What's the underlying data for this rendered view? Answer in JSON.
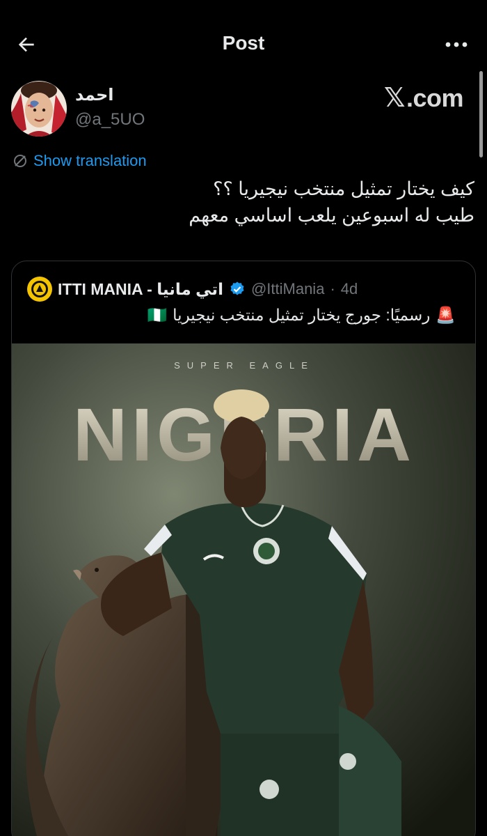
{
  "header": {
    "title": "Post",
    "back_icon": "arrow-left-icon",
    "more_icon": "more-horizontal-icon"
  },
  "author": {
    "name": "احمد",
    "handle": "@a_5UO"
  },
  "watermark": {
    "x": "𝕏",
    "text": ".com"
  },
  "translation": {
    "label": "Show translation"
  },
  "tweet": {
    "lines": [
      "كيف يختار تمثيل منتخب نيجيريا ؟؟",
      "طيب له اسبوعين يلعب اساسي معهم"
    ]
  },
  "quote": {
    "name": "ITTI MANIA - اتي مانيا",
    "handle": "@IttiMania",
    "separator": "·",
    "time": "4d",
    "text": "رسميًا: جورج يختار تمثيل منتخب نيجيريا",
    "siren": "🚨",
    "flag": "🇳🇬",
    "media": {
      "kicker": "SUPER EAGLE",
      "headline": "NIGERIA"
    }
  },
  "colors": {
    "accent": "#1d9bf0",
    "background": "#000000",
    "secondary": "#71767b",
    "verified": "#1d9bf0"
  }
}
